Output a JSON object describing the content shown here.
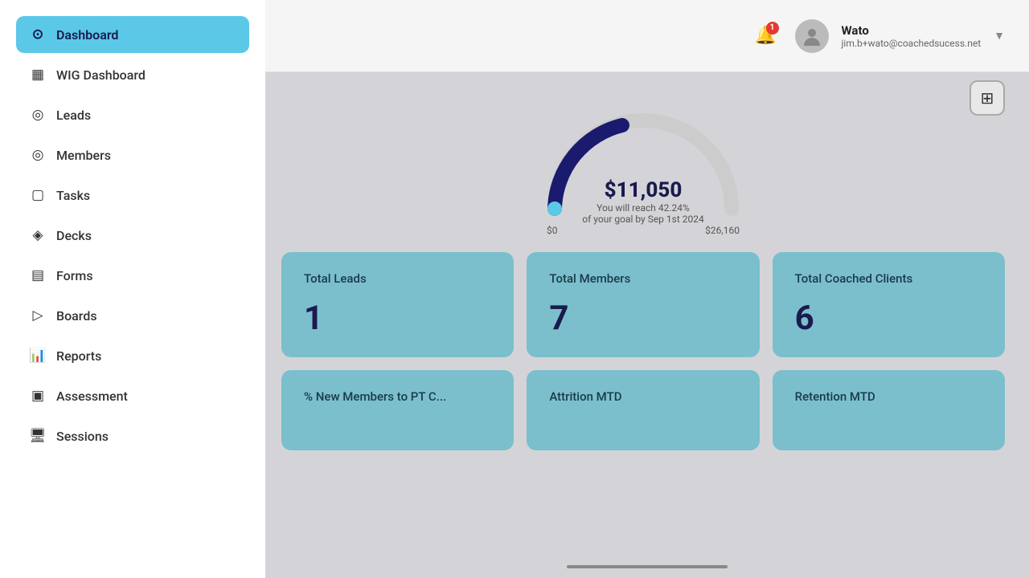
{
  "sidebar": {
    "items": [
      {
        "id": "dashboard",
        "label": "Dashboard",
        "icon": "⊙",
        "active": true
      },
      {
        "id": "wig-dashboard",
        "label": "WIG Dashboard",
        "icon": "≡",
        "active": false
      },
      {
        "id": "leads",
        "label": "Leads",
        "icon": "◎",
        "active": false
      },
      {
        "id": "members",
        "label": "Members",
        "icon": "◎",
        "active": false
      },
      {
        "id": "tasks",
        "label": "Tasks",
        "icon": "▢",
        "active": false
      },
      {
        "id": "decks",
        "label": "Decks",
        "icon": "◈",
        "active": false
      },
      {
        "id": "forms",
        "label": "Forms",
        "icon": "▤",
        "active": false
      },
      {
        "id": "boards",
        "label": "Boards",
        "icon": "▷",
        "active": false
      },
      {
        "id": "reports",
        "label": "Reports",
        "icon": "📊",
        "active": false
      },
      {
        "id": "assessment",
        "label": "Assessment",
        "icon": "▣",
        "active": false
      },
      {
        "id": "sessions",
        "label": "Sessions",
        "icon": "🖥",
        "active": false
      }
    ]
  },
  "header": {
    "notification_count": "1",
    "user": {
      "name": "Wato",
      "email": "jim.b+wato@coachedsucess.net"
    }
  },
  "gauge": {
    "amount": "$11,050",
    "subtitle_line1": "You will reach 42.24%",
    "subtitle_line2": "of your goal by Sep 1st 2024",
    "min_label": "$0",
    "max_label": "$26,160",
    "progress_percent": 42.24
  },
  "stats": [
    {
      "title": "Total Leads",
      "value": "1"
    },
    {
      "title": "Total Members",
      "value": "7"
    },
    {
      "title": "Total Coached Clients",
      "value": "6"
    }
  ],
  "bottom_cards": [
    {
      "title": "% New Members to PT C..."
    },
    {
      "title": "Attrition MTD"
    },
    {
      "title": "Retention MTD"
    }
  ]
}
